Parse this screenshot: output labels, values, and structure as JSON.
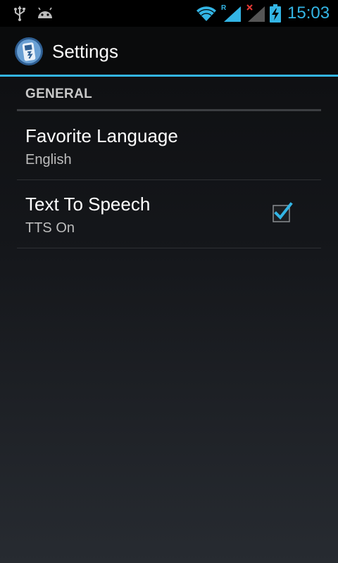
{
  "status_bar": {
    "time": "15:03",
    "roaming_indicator": "R",
    "icons": [
      "usb-icon",
      "android-icon",
      "wifi-icon",
      "signal-icon",
      "no-signal-icon",
      "battery-charging-icon"
    ]
  },
  "action_bar": {
    "title": "Settings",
    "app_icon": "app-icon"
  },
  "section": {
    "header": "GENERAL"
  },
  "preferences": [
    {
      "title": "Favorite Language",
      "summary": "English"
    },
    {
      "title": "Text To Speech",
      "summary": "TTS On",
      "checked": true
    }
  ],
  "colors": {
    "accent": "#33b5e5",
    "background": "#16181c",
    "text_primary": "#ffffff",
    "text_secondary": "#bdbdbd"
  }
}
